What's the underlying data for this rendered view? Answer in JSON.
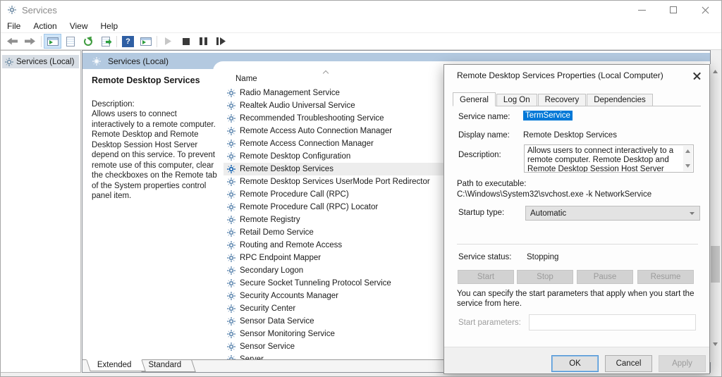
{
  "window": {
    "title": "Services",
    "controls": [
      "minimize-icon",
      "maximize-icon",
      "close-icon"
    ]
  },
  "menu": {
    "items": [
      "File",
      "Action",
      "View",
      "Help"
    ]
  },
  "toolbar": {
    "help_glyph": "?",
    "icons": [
      "back-icon",
      "forward-icon",
      "console-tree-toggle-icon",
      "properties-icon",
      "refresh-icon",
      "export-list-icon",
      "help-icon",
      "action-pane-toggle-icon",
      "start-service-icon",
      "stop-service-icon",
      "pause-service-icon",
      "restart-service-icon"
    ]
  },
  "tree": {
    "root": "Services (Local)"
  },
  "content_header": {
    "title": "Services (Local)"
  },
  "extended_pane": {
    "service_title": "Remote Desktop Services",
    "description_label": "Description:",
    "description": "Allows users to connect interactively to a remote computer. Remote Desktop and Remote Desktop Session Host Server depend on this service. To prevent remote use of this computer, clear the checkboxes on the Remote tab of the System properties control panel item."
  },
  "list": {
    "column_header": "Name",
    "items": [
      {
        "name": "Radio Management Service",
        "selected": false
      },
      {
        "name": "Realtek Audio Universal Service",
        "selected": false
      },
      {
        "name": "Recommended Troubleshooting Service",
        "selected": false
      },
      {
        "name": "Remote Access Auto Connection Manager",
        "selected": false
      },
      {
        "name": "Remote Access Connection Manager",
        "selected": false
      },
      {
        "name": "Remote Desktop Configuration",
        "selected": false
      },
      {
        "name": "Remote Desktop Services",
        "selected": true
      },
      {
        "name": "Remote Desktop Services UserMode Port Redirector",
        "selected": false
      },
      {
        "name": "Remote Procedure Call (RPC)",
        "selected": false
      },
      {
        "name": "Remote Procedure Call (RPC) Locator",
        "selected": false
      },
      {
        "name": "Remote Registry",
        "selected": false
      },
      {
        "name": "Retail Demo Service",
        "selected": false
      },
      {
        "name": "Routing and Remote Access",
        "selected": false
      },
      {
        "name": "RPC Endpoint Mapper",
        "selected": false
      },
      {
        "name": "Secondary Logon",
        "selected": false
      },
      {
        "name": "Secure Socket Tunneling Protocol Service",
        "selected": false
      },
      {
        "name": "Security Accounts Manager",
        "selected": false
      },
      {
        "name": "Security Center",
        "selected": false
      },
      {
        "name": "Sensor Data Service",
        "selected": false
      },
      {
        "name": "Sensor Monitoring Service",
        "selected": false
      },
      {
        "name": "Sensor Service",
        "selected": false
      },
      {
        "name": "Server",
        "selected": false
      }
    ]
  },
  "view_tabs": {
    "items": [
      {
        "label": "Extended",
        "active": true
      },
      {
        "label": "Standard",
        "active": false
      }
    ]
  },
  "dialog": {
    "title": "Remote Desktop Services Properties (Local Computer)",
    "tabs": [
      {
        "label": "General",
        "active": true
      },
      {
        "label": "Log On",
        "active": false
      },
      {
        "label": "Recovery",
        "active": false
      },
      {
        "label": "Dependencies",
        "active": false
      }
    ],
    "fields": {
      "service_name_label": "Service name:",
      "service_name_value": "TermService",
      "display_name_label": "Display name:",
      "display_name_value": "Remote Desktop Services",
      "description_label": "Description:",
      "description_value": "Allows users to connect interactively to a remote computer. Remote Desktop and Remote Desktop Session Host Server depend on this service. To",
      "path_label": "Path to executable:",
      "path_value": "C:\\Windows\\System32\\svchost.exe -k NetworkService",
      "startup_label": "Startup type:",
      "startup_value": "Automatic",
      "status_label": "Service status:",
      "status_value": "Stopping",
      "start_params_hint": "You can specify the start parameters that apply when you start the service from here.",
      "start_params_label": "Start parameters:",
      "start_params_value": ""
    },
    "service_buttons": [
      {
        "label": "Start",
        "enabled": false
      },
      {
        "label": "Stop",
        "enabled": false
      },
      {
        "label": "Pause",
        "enabled": false
      },
      {
        "label": "Resume",
        "enabled": false
      }
    ],
    "footer_buttons": [
      {
        "label": "OK",
        "enabled": true,
        "focused": true
      },
      {
        "label": "Cancel",
        "enabled": true,
        "focused": false
      },
      {
        "label": "Apply",
        "enabled": false,
        "focused": false
      }
    ]
  },
  "colors": {
    "accent": "#0078d7",
    "header_band": "#b3c9e0",
    "selection_highlight": "#0078d7"
  }
}
